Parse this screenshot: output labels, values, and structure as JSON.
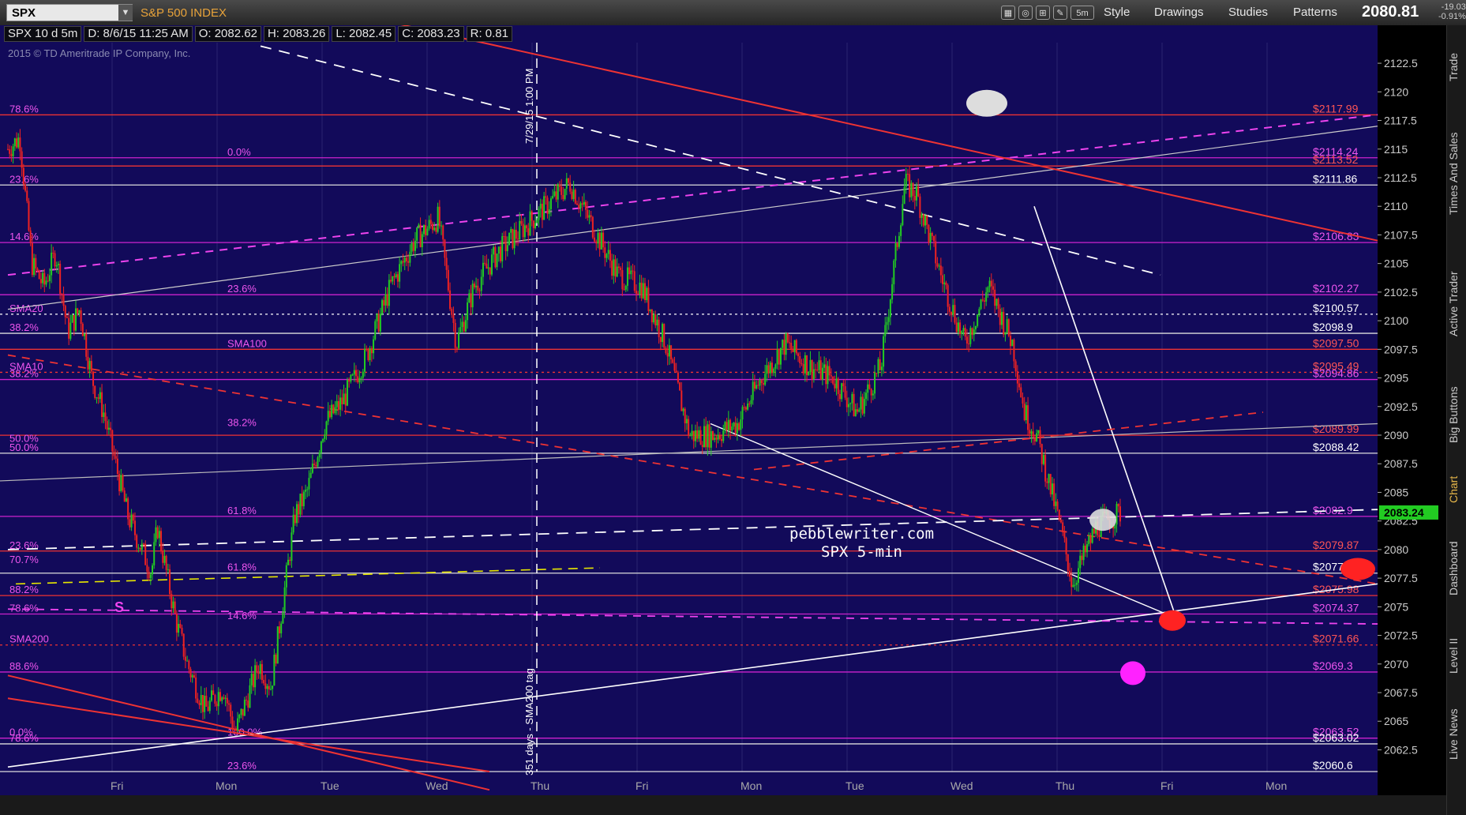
{
  "toolbar": {
    "symbol": "SPX",
    "index_name": "S&P 500 INDEX",
    "timeframe": "5m",
    "style_label": "Style",
    "drawings_label": "Drawings",
    "studies_label": "Studies",
    "patterns_label": "Patterns",
    "last_price": "2080.81",
    "change_abs": "-19.03",
    "change_pct": "-0.91%"
  },
  "side_tabs": [
    "Trade",
    "Times And Sales",
    "Active Trader",
    "Big Buttons",
    "Chart",
    "Dashboard",
    "Level II",
    "Live News"
  ],
  "side_active": "Chart",
  "info_bar": {
    "symbol_period": "SPX 10 d 5m",
    "date": "D: 8/6/15 11:25 AM",
    "open": "O: 2082.62",
    "high": "H: 2083.26",
    "low": "L: 2082.45",
    "close": "C: 2083.23",
    "range": "R: 0.81"
  },
  "copyright": "2015 © TD Ameritrade IP Company, Inc.",
  "annotations": {
    "brand": "pebblewriter.com",
    "subtitle": "SPX 5-min",
    "vertical_note_1": "7/29/15 1:00 PM",
    "vertical_note_2": "351 days - SMA200 tag",
    "s_marker": "S"
  },
  "colors": {
    "background": "#120a5a",
    "candle_up": "#22cc22",
    "candle_down": "#ee2222",
    "fib_magenta": "#dd22dd",
    "red_line": "#ee2222",
    "price_tag_bg": "#22cc22"
  },
  "chart_data": {
    "type": "candlestick",
    "title": "",
    "ylim": [
      2060.6,
      2124.3
    ],
    "y_ticks": [
      "2122.5",
      "2120",
      "2117.5",
      "2115",
      "2112.5",
      "2110",
      "2107.5",
      "2105",
      "2102.5",
      "2100",
      "2097.5",
      "2095",
      "2092.5",
      "2090",
      "2087.5",
      "2085",
      "2082.5",
      "2080",
      "2077.5",
      "2075",
      "2072.5",
      "2070",
      "2067.5",
      "2065",
      "2062.5"
    ],
    "x_labels": [
      "Fri",
      "Mon",
      "Tue",
      "Wed",
      "Thu",
      "Fri",
      "Mon",
      "Tue",
      "Wed",
      "Thu",
      "Fri",
      "Mon"
    ],
    "last_price_tag": "2083.24",
    "price_path": [
      [
        0,
        2115
      ],
      [
        0.02,
        2116
      ],
      [
        0.04,
        2105
      ],
      [
        0.06,
        2103
      ],
      [
        0.08,
        2106
      ],
      [
        0.1,
        2099
      ],
      [
        0.12,
        2101
      ],
      [
        0.14,
        2095
      ],
      [
        0.16,
        2092
      ],
      [
        0.2,
        2083
      ],
      [
        0.24,
        2078
      ],
      [
        0.25,
        2082
      ],
      [
        0.28,
        2074
      ],
      [
        0.3,
        2070
      ],
      [
        0.33,
        2066
      ],
      [
        0.36,
        2068
      ],
      [
        0.38,
        2064
      ],
      [
        0.42,
        2070
      ],
      [
        0.44,
        2068
      ],
      [
        0.48,
        2083
      ],
      [
        0.5,
        2085
      ],
      [
        0.53,
        2091
      ],
      [
        0.56,
        2093
      ],
      [
        0.6,
        2097
      ],
      [
        0.64,
        2103
      ],
      [
        0.68,
        2107
      ],
      [
        0.72,
        2109
      ],
      [
        0.75,
        2098
      ],
      [
        0.78,
        2103
      ],
      [
        0.82,
        2106
      ],
      [
        0.86,
        2108
      ],
      [
        0.9,
        2110
      ],
      [
        0.94,
        2112
      ],
      [
        0.98,
        2108
      ],
      [
        1.02,
        2104
      ],
      [
        1.06,
        2103
      ],
      [
        1.1,
        2098
      ],
      [
        1.14,
        2090
      ],
      [
        1.18,
        2090
      ],
      [
        1.22,
        2091
      ],
      [
        1.26,
        2095
      ],
      [
        1.3,
        2098
      ],
      [
        1.34,
        2096
      ],
      [
        1.38,
        2095
      ],
      [
        1.42,
        2092
      ],
      [
        1.46,
        2096
      ],
      [
        1.5,
        2112
      ],
      [
        1.52,
        2111
      ],
      [
        1.56,
        2104
      ],
      [
        1.6,
        2098
      ],
      [
        1.64,
        2103
      ],
      [
        1.68,
        2098
      ],
      [
        1.7,
        2092
      ],
      [
        1.72,
        2090
      ],
      [
        1.76,
        2082
      ],
      [
        1.78,
        2077
      ],
      [
        1.82,
        2082
      ],
      [
        1.86,
        2083.2
      ]
    ],
    "horizontal_levels": [
      {
        "label": "$2117.99",
        "value": 2117.99,
        "style": "red"
      },
      {
        "label": "$2114.24",
        "value": 2114.24,
        "style": "magenta"
      },
      {
        "label": "$2113.52",
        "value": 2113.52,
        "style": "red"
      },
      {
        "label": "$2111.86",
        "value": 2111.86,
        "style": "white"
      },
      {
        "label": "$2106.83",
        "value": 2106.83,
        "style": "magenta"
      },
      {
        "label": "$2102.27",
        "value": 2102.27,
        "style": "magenta"
      },
      {
        "label": "$2100.57",
        "value": 2100.57,
        "style": "white-dotted"
      },
      {
        "label": "$2098.9",
        "value": 2098.9,
        "style": "white"
      },
      {
        "label": "$2097.50",
        "value": 2097.5,
        "style": "red"
      },
      {
        "label": "$2095.49",
        "value": 2095.49,
        "style": "red-dotted"
      },
      {
        "label": "$2094.86",
        "value": 2094.86,
        "style": "magenta"
      },
      {
        "label": "$2089.99",
        "value": 2089.99,
        "style": "red"
      },
      {
        "label": "$2088.42",
        "value": 2088.42,
        "style": "white"
      },
      {
        "label": "$2082.9",
        "value": 2082.9,
        "style": "magenta"
      },
      {
        "label": "$2079.87",
        "value": 2079.87,
        "style": "red"
      },
      {
        "label": "$2077.94",
        "value": 2077.94,
        "style": "white"
      },
      {
        "label": "$2075.98",
        "value": 2075.98,
        "style": "red"
      },
      {
        "label": "$2074.37",
        "value": 2074.37,
        "style": "magenta"
      },
      {
        "label": "$2071.66",
        "value": 2071.66,
        "style": "red-dotted"
      },
      {
        "label": "$2069.3",
        "value": 2069.3,
        "style": "magenta"
      },
      {
        "label": "$2063.52",
        "value": 2063.52,
        "style": "magenta"
      },
      {
        "label": "$2063.02",
        "value": 2063.02,
        "style": "white"
      },
      {
        "label": "$2060.6",
        "value": 2060.6,
        "style": "white"
      }
    ],
    "fib_labels_left": [
      {
        "label": "78.6%",
        "value": 2117.99
      },
      {
        "label": "0.0%",
        "value": 2114.24
      },
      {
        "label": "23.6%",
        "value": 2111.86
      },
      {
        "label": "14.6%",
        "value": 2106.83
      },
      {
        "label": "23.6%",
        "value": 2102.27
      },
      {
        "label": "SMA20",
        "value": 2100.57
      },
      {
        "label": "38.2%",
        "value": 2098.9
      },
      {
        "label": "SMA100",
        "value": 2097.5
      },
      {
        "label": "SMA10",
        "value": 2095.49
      },
      {
        "label": "38.2%",
        "value": 2094.86
      },
      {
        "label": "38.2%",
        "value": 2090.6
      },
      {
        "label": "50.0%",
        "value": 2088.42
      },
      {
        "label": "50.0%",
        "value": 2089.2
      },
      {
        "label": "61.8%",
        "value": 2082.9
      },
      {
        "label": "23.6%",
        "value": 2079.87
      },
      {
        "label": "70.7%",
        "value": 2078.6
      },
      {
        "label": "61.8%",
        "value": 2077.94
      },
      {
        "label": "88.2%",
        "value": 2075.98
      },
      {
        "label": "78.6%",
        "value": 2074.37
      },
      {
        "label": "14.6%",
        "value": 2073.7
      },
      {
        "label": "SMA200",
        "value": 2071.66
      },
      {
        "label": "88.6%",
        "value": 2069.3
      },
      {
        "label": "100.0%",
        "value": 2063.52
      },
      {
        "label": "78.6%",
        "value": 2063.02
      },
      {
        "label": "0.0%",
        "value": 2063.52
      },
      {
        "label": "23.6%",
        "value": 2060.6
      }
    ]
  }
}
